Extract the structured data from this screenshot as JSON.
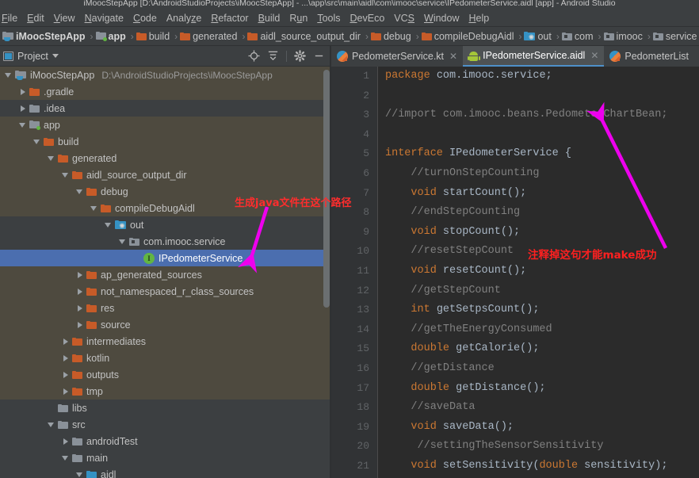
{
  "window": {
    "title": "iMoocStepApp [D:\\AndroidStudioProjects\\iMoocStepApp] - ...\\app\\src\\main\\aidl\\com\\imooc\\service\\IPedometerService.aidl [app] - Android Studio"
  },
  "menubar": {
    "items": [
      {
        "label": "File",
        "mnemonic_index": 0
      },
      {
        "label": "Edit",
        "mnemonic_index": 0
      },
      {
        "label": "View",
        "mnemonic_index": 0
      },
      {
        "label": "Navigate",
        "mnemonic_index": 0
      },
      {
        "label": "Code",
        "mnemonic_index": 0
      },
      {
        "label": "Analyze",
        "mnemonic_index": 5
      },
      {
        "label": "Refactor",
        "mnemonic_index": 0
      },
      {
        "label": "Build",
        "mnemonic_index": 0
      },
      {
        "label": "Run",
        "mnemonic_index": 1
      },
      {
        "label": "Tools",
        "mnemonic_index": 0
      },
      {
        "label": "DevEco",
        "mnemonic_index": 0
      },
      {
        "label": "VCS",
        "mnemonic_index": 2
      },
      {
        "label": "Window",
        "mnemonic_index": 0
      },
      {
        "label": "Help",
        "mnemonic_index": 0
      }
    ]
  },
  "breadcrumb": {
    "items": [
      {
        "label": "iMoocStepApp",
        "icon": "project-icon",
        "bold": true
      },
      {
        "label": "app",
        "icon": "module-icon",
        "bold": true
      },
      {
        "label": "build",
        "icon": "folder-orange-icon",
        "bold": false
      },
      {
        "label": "generated",
        "icon": "folder-orange-icon",
        "bold": false
      },
      {
        "label": "aidl_source_output_dir",
        "icon": "folder-orange-icon",
        "bold": false
      },
      {
        "label": "debug",
        "icon": "folder-orange-icon",
        "bold": false
      },
      {
        "label": "compileDebugAidl",
        "icon": "folder-orange-icon",
        "bold": false
      },
      {
        "label": "out",
        "icon": "folder-generated-icon",
        "bold": false
      },
      {
        "label": "com",
        "icon": "package-icon",
        "bold": false
      },
      {
        "label": "imooc",
        "icon": "package-icon",
        "bold": false
      },
      {
        "label": "service",
        "icon": "package-icon",
        "bold": false
      }
    ]
  },
  "project_panel": {
    "title": "Project",
    "toolbar_icons": [
      "locate-target-icon",
      "collapse-all-icon",
      "gear-icon",
      "minimize-icon"
    ],
    "tree": [
      {
        "label": "iMoocStepApp",
        "path": "D:\\AndroidStudioProjects\\iMoocStepApp",
        "indent": 0,
        "arrow": "down",
        "icon": "project-icon",
        "state": "highlight"
      },
      {
        "label": ".gradle",
        "indent": 1,
        "arrow": "right",
        "icon": "folder-orange-icon",
        "state": "highlight"
      },
      {
        "label": ".idea",
        "indent": 1,
        "arrow": "right",
        "icon": "folder-grey-icon",
        "state": "normal"
      },
      {
        "label": "app",
        "indent": 1,
        "arrow": "down",
        "icon": "module-icon",
        "state": "highlight"
      },
      {
        "label": "build",
        "indent": 2,
        "arrow": "down",
        "icon": "folder-orange-icon",
        "state": "highlight"
      },
      {
        "label": "generated",
        "indent": 3,
        "arrow": "down",
        "icon": "folder-orange-icon",
        "state": "highlight"
      },
      {
        "label": "aidl_source_output_dir",
        "indent": 4,
        "arrow": "down",
        "icon": "folder-orange-icon",
        "state": "highlight"
      },
      {
        "label": "debug",
        "indent": 5,
        "arrow": "down",
        "icon": "folder-orange-icon",
        "state": "highlight"
      },
      {
        "label": "compileDebugAidl",
        "indent": 6,
        "arrow": "down",
        "icon": "folder-orange-icon",
        "state": "highlight"
      },
      {
        "label": "out",
        "indent": 7,
        "arrow": "down",
        "icon": "folder-generated-icon",
        "state": "normal"
      },
      {
        "label": "com.imooc.service",
        "indent": 8,
        "arrow": "down",
        "icon": "package-icon",
        "state": "normal"
      },
      {
        "label": "IPedometerService",
        "indent": 9,
        "arrow": "none",
        "icon": "interface-icon",
        "state": "selected"
      },
      {
        "label": "ap_generated_sources",
        "indent": 5,
        "arrow": "right",
        "icon": "folder-orange-icon",
        "state": "highlight"
      },
      {
        "label": "not_namespaced_r_class_sources",
        "indent": 5,
        "arrow": "right",
        "icon": "folder-orange-icon",
        "state": "highlight"
      },
      {
        "label": "res",
        "indent": 5,
        "arrow": "right",
        "icon": "folder-orange-icon",
        "state": "highlight"
      },
      {
        "label": "source",
        "indent": 5,
        "arrow": "right",
        "icon": "folder-orange-icon",
        "state": "highlight"
      },
      {
        "label": "intermediates",
        "indent": 4,
        "arrow": "right",
        "icon": "folder-orange-icon",
        "state": "highlight"
      },
      {
        "label": "kotlin",
        "indent": 4,
        "arrow": "right",
        "icon": "folder-orange-icon",
        "state": "highlight"
      },
      {
        "label": "outputs",
        "indent": 4,
        "arrow": "right",
        "icon": "folder-orange-icon",
        "state": "highlight"
      },
      {
        "label": "tmp",
        "indent": 4,
        "arrow": "right",
        "icon": "folder-orange-icon",
        "state": "highlight"
      },
      {
        "label": "libs",
        "indent": 3,
        "arrow": "none",
        "icon": "folder-grey-icon",
        "state": "normal"
      },
      {
        "label": "src",
        "indent": 3,
        "arrow": "down",
        "icon": "folder-grey-icon",
        "state": "normal"
      },
      {
        "label": "androidTest",
        "indent": 4,
        "arrow": "right",
        "icon": "folder-grey-icon",
        "state": "normal"
      },
      {
        "label": "main",
        "indent": 4,
        "arrow": "down",
        "icon": "folder-grey-icon",
        "state": "normal"
      },
      {
        "label": "aidl",
        "indent": 5,
        "arrow": "down",
        "icon": "folder-blue-icon",
        "state": "normal"
      }
    ]
  },
  "editor": {
    "tabs": [
      {
        "label": "PedometerService.kt",
        "icon": "kotlin-file-icon",
        "active": false,
        "closable": true
      },
      {
        "label": "IPedometerService.aidl",
        "icon": "android-file-icon",
        "active": true,
        "closable": true
      },
      {
        "label": "PedometerList",
        "icon": "kotlin-file-icon",
        "active": false,
        "closable": false
      }
    ],
    "lines": [
      {
        "num": "1",
        "tokens": [
          {
            "t": "package",
            "c": "kw"
          },
          {
            "t": " com.imooc.service;",
            "c": "pl"
          }
        ]
      },
      {
        "num": "2",
        "tokens": []
      },
      {
        "num": "3",
        "tokens": [
          {
            "t": "//import com.imooc.beans.PedometerChartBean;",
            "c": "cm"
          }
        ]
      },
      {
        "num": "4",
        "tokens": []
      },
      {
        "num": "5",
        "tokens": [
          {
            "t": "interface",
            "c": "kw"
          },
          {
            "t": " IPedometerService {",
            "c": "pl"
          }
        ]
      },
      {
        "num": "6",
        "tokens": [
          {
            "t": "    //turnOnStepCounting",
            "c": "cm"
          }
        ]
      },
      {
        "num": "7",
        "tokens": [
          {
            "t": "    ",
            "c": "pl"
          },
          {
            "t": "void",
            "c": "kw"
          },
          {
            "t": " startCount();",
            "c": "pl"
          }
        ]
      },
      {
        "num": "8",
        "tokens": [
          {
            "t": "    //endStepCounting",
            "c": "cm"
          }
        ]
      },
      {
        "num": "9",
        "tokens": [
          {
            "t": "    ",
            "c": "pl"
          },
          {
            "t": "void",
            "c": "kw"
          },
          {
            "t": " stopCount();",
            "c": "pl"
          }
        ]
      },
      {
        "num": "10",
        "tokens": [
          {
            "t": "    //resetStepCount",
            "c": "cm"
          }
        ]
      },
      {
        "num": "11",
        "tokens": [
          {
            "t": "    ",
            "c": "pl"
          },
          {
            "t": "void",
            "c": "kw"
          },
          {
            "t": " resetCount();",
            "c": "pl"
          }
        ]
      },
      {
        "num": "12",
        "tokens": [
          {
            "t": "    //getStepCount",
            "c": "cm"
          }
        ]
      },
      {
        "num": "13",
        "tokens": [
          {
            "t": "    ",
            "c": "pl"
          },
          {
            "t": "int",
            "c": "kw"
          },
          {
            "t": " getSetpsCount();",
            "c": "pl"
          }
        ]
      },
      {
        "num": "14",
        "tokens": [
          {
            "t": "    //getTheEnergyConsumed",
            "c": "cm"
          }
        ]
      },
      {
        "num": "15",
        "tokens": [
          {
            "t": "    ",
            "c": "pl"
          },
          {
            "t": "double",
            "c": "kw"
          },
          {
            "t": " getCalorie();",
            "c": "pl"
          }
        ]
      },
      {
        "num": "16",
        "tokens": [
          {
            "t": "    //getDistance",
            "c": "cm"
          }
        ]
      },
      {
        "num": "17",
        "tokens": [
          {
            "t": "    ",
            "c": "pl"
          },
          {
            "t": "double",
            "c": "kw"
          },
          {
            "t": " getDistance();",
            "c": "pl"
          }
        ]
      },
      {
        "num": "18",
        "tokens": [
          {
            "t": "    //saveData",
            "c": "cm"
          }
        ]
      },
      {
        "num": "19",
        "tokens": [
          {
            "t": "    ",
            "c": "pl"
          },
          {
            "t": "void",
            "c": "kw"
          },
          {
            "t": " saveData();",
            "c": "pl"
          }
        ]
      },
      {
        "num": "20",
        "tokens": [
          {
            "t": "     //settingTheSensorSensitivity",
            "c": "cm"
          }
        ]
      },
      {
        "num": "21",
        "tokens": [
          {
            "t": "    ",
            "c": "pl"
          },
          {
            "t": "void",
            "c": "kw"
          },
          {
            "t": " setSensitivity(",
            "c": "pl"
          },
          {
            "t": "double",
            "c": "kw"
          },
          {
            "t": " sensitivity);",
            "c": "pl"
          }
        ]
      }
    ]
  },
  "annotations": [
    {
      "text": "生成java文件在这个路径",
      "color": "#ff2d2d",
      "arrow_color": "#ee00ee"
    },
    {
      "text": "注释掉这句才能make成功",
      "color": "#ff2020",
      "arrow_color": "#ee00ee"
    }
  ],
  "colors": {
    "chrome_bg": "#3c3f41",
    "editor_bg": "#2b2b2b",
    "gutter_bg": "#313335",
    "tree_highlight": "#4e4a3f",
    "tree_selected": "#4b6eaf",
    "keyword": "#cc7832",
    "comment": "#808080",
    "plain_text": "#a9b7c6",
    "folder_orange": "#c75b28",
    "folder_grey": "#8a9199",
    "accent_blue": "#4e90c9",
    "annotation_red": "#ff2d2d",
    "annotation_arrow": "#ee00ee"
  }
}
